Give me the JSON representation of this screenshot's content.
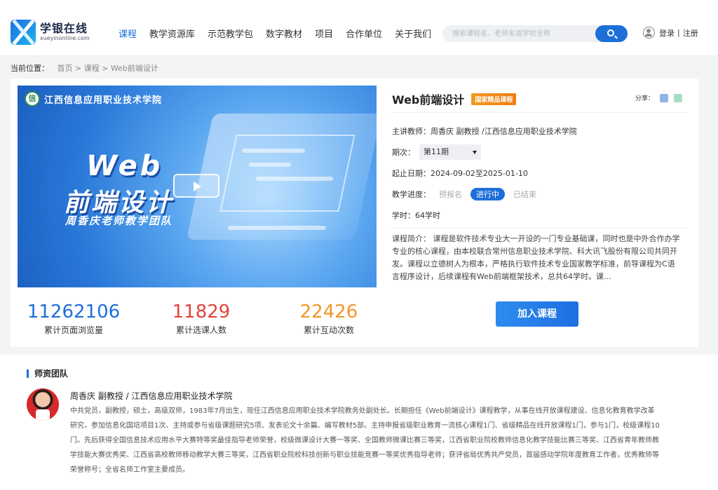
{
  "header": {
    "logo_cn": "学银在线",
    "logo_en": "xueyinonline.com",
    "nav": [
      "课程",
      "教学资源库",
      "示范教学包",
      "数字教材",
      "项目",
      "合作单位",
      "关于我们"
    ],
    "search_placeholder": "搜索课程名、老师名或学校全称",
    "login": "登录",
    "separator": "|",
    "register": "注册"
  },
  "breadcrumb": {
    "label": "当前位置：",
    "home": "首页",
    "sep": ">",
    "courses": "课程",
    "current": "Web前端设计"
  },
  "cover": {
    "school": "江西信息应用职业技术学院",
    "seal": "信",
    "title_line1": "Web",
    "title_line2": "前端设计",
    "subtitle": "周香庆老师教学团队"
  },
  "stats": [
    {
      "value": "11262106",
      "label": "累计页面浏览量",
      "color": "#1d6fd8"
    },
    {
      "value": "11829",
      "label": "累计选课人数",
      "color": "#e0443a"
    },
    {
      "value": "22426",
      "label": "累计互动次数",
      "color": "#f0962a"
    }
  ],
  "course": {
    "title": "Web前端设计",
    "badge": "国家精品课程",
    "share_label": "分享：",
    "teacher_label": "主讲教师：",
    "teacher": "周香庆 副教授 /江西信息应用职业技术学院",
    "term_label": "期次：",
    "term": "第11期",
    "dates_label": "起止日期：",
    "dates": "2024-09-02至2025-01-10",
    "progress_label": "教学进度：",
    "progress": [
      "预报名",
      "进行中",
      "已结束"
    ],
    "hours_label": "学时：",
    "hours": "64学时",
    "desc_label": "课程简介：",
    "desc": "课程是软件技术专业大一开设的一门专业基础课，同时也是中外合作办学专业的核心课程，由本校联合常州信息职业技术学院、科大讯飞股份有限公司共同开发。课程以立德树人为根本，严格执行软件技术专业国家教学标准，前导课程为C语言程序设计，后续课程有Web前端框架技术，总共64学时。课...",
    "join": "加入课程"
  },
  "team": {
    "title": "师资团队",
    "name": "周香庆 副教授 / 江西信息应用职业技术学院",
    "bio": "中共党员，副教授，硕士，高级双师，1983年7月出生，现任江西信息应用职业技术学院教务处副处长。长期担任《Web前端设计》课程教学，从事在线开放课程建设、信息化教育教学改革研究，参加信息化国培项目1次、主持或参与省级课题研究5项、发表论文十余篇、编写教材5部。主持申报省级职业教育一流核心课程1门、省级精品在线开放课程1门，参与1门，校级课程10门。先后获得全国信息技术应用水平大赛特等奖最佳指导老师荣誉，校级微课设计大赛一等奖、全国教师微课比赛三等奖，江西省职业院校教师信息化教学技能比赛三等奖、江西省青年教师教学技能大赛优秀奖、江西省高校教师移动教学大赛三等奖，江西省职业院校科技创新与职业技能竞赛一等奖优秀指导老师；获评省局优秀共产党员，首届感动学院年度教育工作者，优秀教师等荣誉称号；全省名师工作室主要成员。"
  }
}
